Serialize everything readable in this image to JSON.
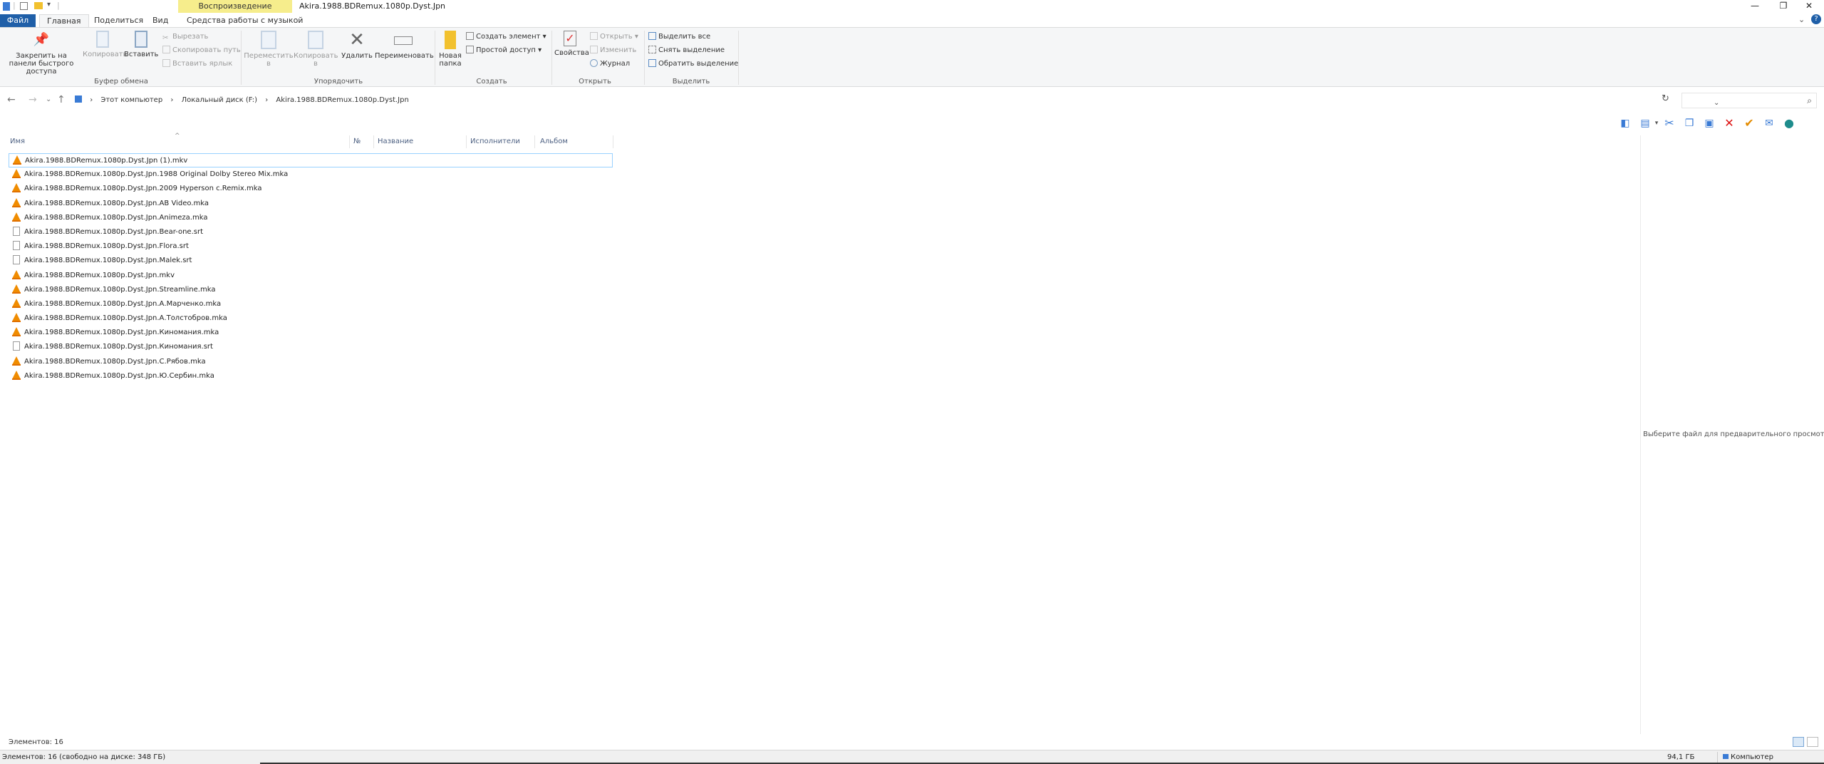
{
  "titlebar": {
    "context_tab": "Воспроизведение",
    "title": "Akira.1988.BDRemux.1080p.Dyst.Jpn",
    "minimize": "—",
    "maximize": "❐",
    "close": "✕"
  },
  "tabs": {
    "file": "Файл",
    "home": "Главная",
    "share": "Поделиться",
    "view": "Вид",
    "music_tools": "Средства работы с музыкой"
  },
  "ribbon": {
    "clipboard": {
      "pin": "Закрепить на панели быстрого доступа",
      "copy": "Копировать",
      "paste": "Вставить",
      "cut": "Вырезать",
      "copy_path": "Скопировать путь",
      "paste_shortcut": "Вставить ярлык",
      "label": "Буфер обмена"
    },
    "organize": {
      "move": "Переместить в",
      "copy_to": "Копировать в",
      "delete": "Удалить",
      "rename": "Переименовать",
      "label": "Упорядочить"
    },
    "create": {
      "new_folder": "Новая папка",
      "new_item": "Создать элемент",
      "easy_access": "Простой доступ",
      "label": "Создать"
    },
    "open": {
      "properties": "Свойства",
      "open": "Открыть",
      "edit": "Изменить",
      "history": "Журнал",
      "label": "Открыть"
    },
    "select": {
      "select_all": "Выделить все",
      "select_none": "Снять выделение",
      "invert": "Обратить выделение",
      "label": "Выделить"
    }
  },
  "address": {
    "crumbs": [
      "Этот компьютер",
      "Локальный диск (F:)",
      "Akira.1988.BDRemux.1080p.Dyst.Jpn"
    ],
    "search_placeholder": ""
  },
  "columns": {
    "name": "Имя",
    "number": "№",
    "title": "Название",
    "artist": "Исполнители",
    "album": "Альбом"
  },
  "files": [
    {
      "name": "Akira.1988.BDRemux.1080p.Dyst.Jpn (1).mkv",
      "icon": "vlc-icon"
    },
    {
      "name": "Akira.1988.BDRemux.1080p.Dyst.Jpn.1988 Original Dolby Stereo Mix.mka",
      "icon": "vlc-icon"
    },
    {
      "name": "Akira.1988.BDRemux.1080p.Dyst.Jpn.2009 Hyperson c.Remix.mka",
      "icon": "vlc-icon"
    },
    {
      "name": "Akira.1988.BDRemux.1080p.Dyst.Jpn.AB Video.mka",
      "icon": "vlc-icon"
    },
    {
      "name": "Akira.1988.BDRemux.1080p.Dyst.Jpn.Animeza.mka",
      "icon": "vlc-icon"
    },
    {
      "name": "Akira.1988.BDRemux.1080p.Dyst.Jpn.Bear-one.srt",
      "icon": "doc-icon"
    },
    {
      "name": "Akira.1988.BDRemux.1080p.Dyst.Jpn.Flora.srt",
      "icon": "doc-icon"
    },
    {
      "name": "Akira.1988.BDRemux.1080p.Dyst.Jpn.Malek.srt",
      "icon": "doc-icon"
    },
    {
      "name": "Akira.1988.BDRemux.1080p.Dyst.Jpn.mkv",
      "icon": "vlc-icon"
    },
    {
      "name": "Akira.1988.BDRemux.1080p.Dyst.Jpn.Streamline.mka",
      "icon": "vlc-icon"
    },
    {
      "name": "Akira.1988.BDRemux.1080p.Dyst.Jpn.А.Марченко.mka",
      "icon": "vlc-icon"
    },
    {
      "name": "Akira.1988.BDRemux.1080p.Dyst.Jpn.А.Толстобров.mka",
      "icon": "vlc-icon"
    },
    {
      "name": "Akira.1988.BDRemux.1080p.Dyst.Jpn.Киномания.mka",
      "icon": "vlc-icon"
    },
    {
      "name": "Akira.1988.BDRemux.1080p.Dyst.Jpn.Киномания.srt",
      "icon": "doc-icon"
    },
    {
      "name": "Akira.1988.BDRemux.1080p.Dyst.Jpn.С.Рябов.mka",
      "icon": "vlc-icon"
    },
    {
      "name": "Akira.1988.BDRemux.1080p.Dyst.Jpn.Ю.Сербин.mka",
      "icon": "vlc-icon"
    }
  ],
  "preview_text": "Выберите файл для предварительного просмотра.",
  "status": {
    "count": "Элементов: 16",
    "left": "Элементов: 16 (свободно на диске: 348 ГБ)",
    "size": "94,1 ГБ",
    "zone": "Компьютер"
  }
}
